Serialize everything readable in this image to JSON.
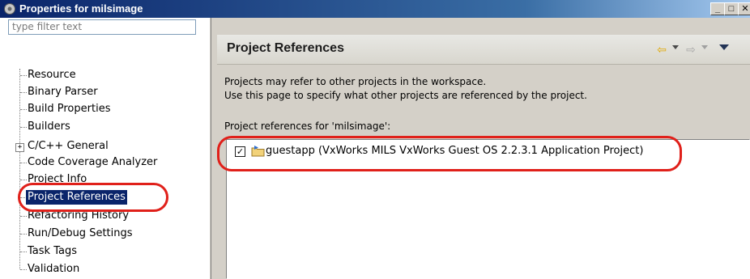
{
  "window": {
    "title": "Properties for milsimage",
    "icon": "settings-gear-icon",
    "controls": {
      "minimize": "_",
      "maximize": "□",
      "close": "✕"
    }
  },
  "filter": {
    "placeholder": "type filter text"
  },
  "tree": {
    "items": [
      {
        "label": "Resource"
      },
      {
        "label": "Binary Parser"
      },
      {
        "label": "Build Properties"
      },
      {
        "label": "Builders"
      },
      {
        "label": "C/C++ General",
        "expandable": true,
        "expander": "+"
      },
      {
        "label": "Code Coverage Analyzer"
      },
      {
        "label": "Project Info"
      },
      {
        "label": "Project References",
        "selected": true
      },
      {
        "label": "Refactoring History"
      },
      {
        "label": "Run/Debug Settings"
      },
      {
        "label": "Task Tags"
      },
      {
        "label": "Validation"
      }
    ]
  },
  "page": {
    "title": "Project References",
    "nav": {
      "back_icon": "back-arrow-icon",
      "forward_icon": "forward-arrow-icon",
      "menu_icon": "view-menu-icon"
    },
    "description_line1": "Projects may refer to other projects in the workspace.",
    "description_line2": "Use this page to specify what other projects are referenced by the project.",
    "references_label": "Project references for 'milsimage':",
    "projects": [
      {
        "label": "guestapp (VxWorks MILS VxWorks Guest OS 2.2.3.1 Application Project)",
        "checked": true
      }
    ]
  },
  "colors": {
    "selection": "#0a246a",
    "highlight_callout": "#e0201a",
    "title_bar": "#0a246a"
  }
}
